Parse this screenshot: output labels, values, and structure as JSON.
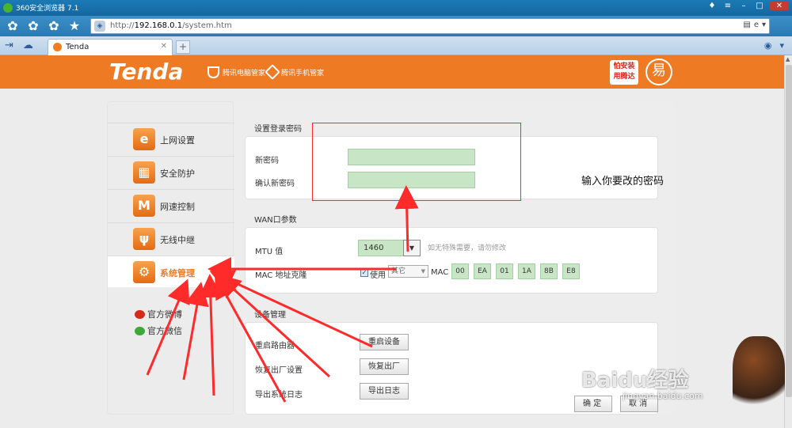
{
  "browser": {
    "title": "360安全浏览器 7.1",
    "url_prefix": "http://",
    "url_host": "192.168.0.1",
    "url_path": "/system.htm",
    "tab_label": "Tenda",
    "newtab": "+"
  },
  "brand": {
    "logo": "Tenda",
    "partner1": "腾讯电脑管家",
    "partner2": "腾讯手机管家",
    "badge_line1": "怕安装",
    "badge_line2": "用腾达"
  },
  "sidebar": {
    "items": [
      {
        "label": "上网设置",
        "icon": "e"
      },
      {
        "label": "安全防护",
        "icon": "▦"
      },
      {
        "label": "网速控制",
        "icon": "M"
      },
      {
        "label": "无线中继",
        "icon": "ψ"
      },
      {
        "label": "系统管理",
        "icon": "⚙"
      }
    ],
    "weibo": "官方微博",
    "wechat": "官方微信"
  },
  "password": {
    "section": "设置登录密码",
    "new_label": "新密码",
    "confirm_label": "确认新密码"
  },
  "wan": {
    "section": "WAN口参数",
    "mtu_label": "MTU 值",
    "mtu_value": "1460",
    "mtu_hint": "如无特殊需要，请勿修改",
    "mac_label": "MAC 地址克隆",
    "use_label": "使用",
    "select_value": "其它",
    "mac_text": "MAC",
    "mac": [
      "00",
      "EA",
      "01",
      "1A",
      "8B",
      "E8"
    ]
  },
  "device": {
    "section": "设备管理",
    "reboot_label": "重启路由器",
    "reboot_btn": "重启设备",
    "factory_label": "恢复出厂设置",
    "factory_btn": "恢复出厂",
    "export_label": "导出系统日志",
    "export_btn": "导出日志"
  },
  "footer": {
    "ok": "确 定",
    "cancel": "取 消"
  },
  "annotation": "输入你要改的密码",
  "watermark": {
    "text": "Baidu经验",
    "url": "jingyan.baidu.com"
  }
}
